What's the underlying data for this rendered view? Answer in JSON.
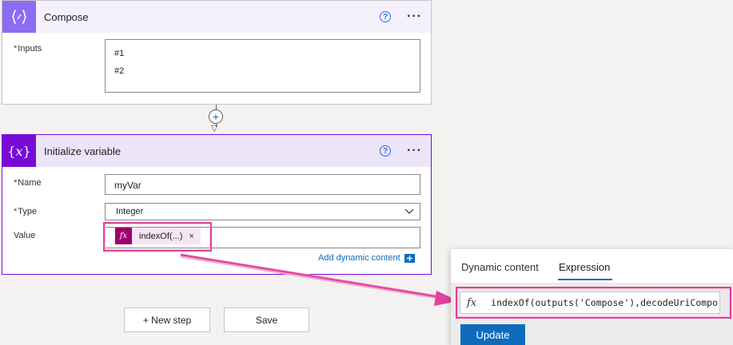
{
  "compose": {
    "title": "Compose",
    "icon": "braces-icon",
    "help_glyph": "?",
    "more_glyph": "···",
    "inputs_label": "Inputs",
    "required_mark": "*",
    "inputs_lines": [
      "#1",
      "#2"
    ],
    "header_color": "#f4f0fc",
    "icon_color": "#8c6cf2"
  },
  "connector": {
    "plus_glyph": "+",
    "arrow_glyph": "▽"
  },
  "init_variable": {
    "title": "Initialize variable",
    "icon": "variable-x-icon",
    "icon_glyph": "{𝑥}",
    "help_glyph": "?",
    "more_glyph": "···",
    "header_color": "#ece4f8",
    "icon_color": "#770bd6",
    "required_mark": "*",
    "name_label": "Name",
    "name_value": "myVar",
    "type_label": "Type",
    "type_value": "Integer",
    "value_label": "Value",
    "token_fx": "fx",
    "token_label": "indexOf(...)",
    "token_close": "×",
    "add_dynamic_label": "Add dynamic content"
  },
  "actions": {
    "new_step_label": "+ New step",
    "save_label": "Save"
  },
  "expression_panel": {
    "tabs": [
      "Dynamic content",
      "Expression"
    ],
    "active_tab": "Expression",
    "fx_glyph": "fx",
    "expression_text": "indexOf(outputs('Compose'),decodeUriCompo",
    "update_label": "Update"
  },
  "colors": {
    "highlight": "#e0429b",
    "accent": "#0f6cbd",
    "token": "#a0006e"
  }
}
